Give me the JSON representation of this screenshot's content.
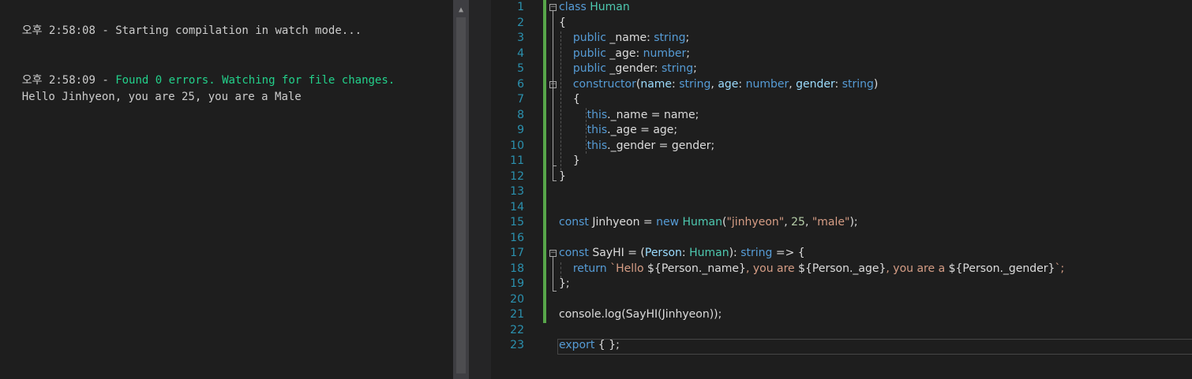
{
  "terminal": {
    "lines": [
      {
        "pre": "오후 2:58:08 - Starting compilation in watch mode...",
        "msg": ""
      },
      {
        "pre": "오후 2:58:09 - ",
        "msg": "Found 0 errors. Watching for file changes."
      },
      {
        "pre": "Hello Jinhyeon, you are 25, you are a Male",
        "msg": ""
      }
    ]
  },
  "editor": {
    "line_numbers": [
      "1",
      "2",
      "3",
      "4",
      "5",
      "6",
      "7",
      "8",
      "9",
      "10",
      "11",
      "12",
      "13",
      "14",
      "15",
      "16",
      "17",
      "18",
      "19",
      "20",
      "21",
      "22",
      "23"
    ],
    "code": {
      "l1_kw": "class",
      "l1_type": "Human",
      "l2": "{",
      "l3_kw": "public",
      "l3_name": "_name: ",
      "l3_type": "string",
      "l3_end": ";",
      "l4_kw": "public",
      "l4_name": "_age: ",
      "l4_type": "number",
      "l4_end": ";",
      "l5_kw": "public",
      "l5_name": "_gender: ",
      "l5_type": "string",
      "l5_end": ";",
      "l6_kw": "constructor",
      "l6_p1": "name",
      "l6_t1": "string",
      "l6_p2": "age",
      "l6_t2": "number",
      "l6_p3": "gender",
      "l6_t3": "string",
      "l7": "{",
      "l8_kw": "this",
      "l8_rest": "._name = name;",
      "l9_kw": "this",
      "l9_rest": "._age = age;",
      "l10_kw": "this",
      "l10_rest": "._gender = gender;",
      "l11": "}",
      "l12": "}",
      "l15_kw": "const",
      "l15_a": " Jinhyeon = ",
      "l15_new": "new",
      "l15_type": "Human",
      "l15_s1": "\"jinhyeon\"",
      "l15_n": "25",
      "l15_s2": "\"male\"",
      "l17_kw": "const",
      "l17_a": " SayHI = (",
      "l17_param": "Person",
      "l17_type": "Human",
      "l17_rt": "string",
      "l17_end": " => {",
      "l18_kw": "return",
      "l18_t1": " `Hello ",
      "l18_e1": "${Person._name}",
      "l18_t2": ", you are ",
      "l18_e2": "${Person._age}",
      "l18_t3": ", you are a ",
      "l18_e3": "${Person._gender}",
      "l18_t4": "`;",
      "l19": "};",
      "l21": "console.log(SayHI(Jinhyeon));",
      "l23_kw": "export",
      "l23_rest": " { };"
    }
  }
}
